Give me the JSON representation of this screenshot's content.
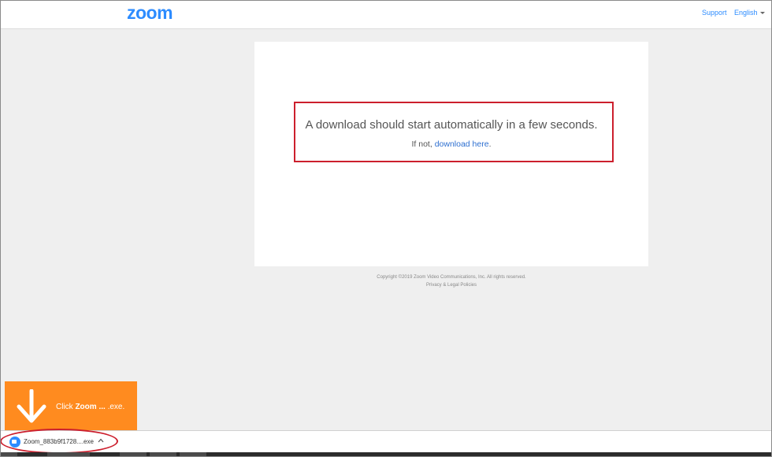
{
  "header": {
    "logo": "zoom",
    "support_label": "Support",
    "language_label": "English"
  },
  "main": {
    "download_message": "A download should start automatically in a few seconds.",
    "if_not_prefix": "If not, ",
    "download_link": "download here",
    "if_not_suffix": "."
  },
  "footer": {
    "copyright": "Copyright ©2019 Zoom Video Communications, Inc. All rights reserved.",
    "legal": "Privacy & Legal Policies"
  },
  "hint": {
    "prefix": "Click ",
    "bold": "Zoom ... ",
    "suffix": ".exe."
  },
  "download_shelf": {
    "filename": "Zoom_883b9f1728....exe"
  },
  "colors": {
    "brand": "#2d8cff",
    "highlight": "#cc1f2d",
    "hint_bg": "#ff8b1f"
  },
  "icons": [
    "arrow-down-icon",
    "zoom-app-icon",
    "chevron-up-icon",
    "caret-down-icon"
  ]
}
